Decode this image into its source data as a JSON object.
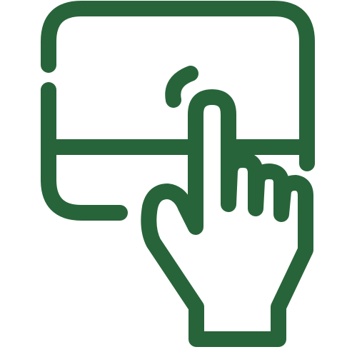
{
  "icon": {
    "name": "touchpad-tap-icon",
    "stroke_color": "#28643a",
    "background_color": "#ffffff"
  }
}
